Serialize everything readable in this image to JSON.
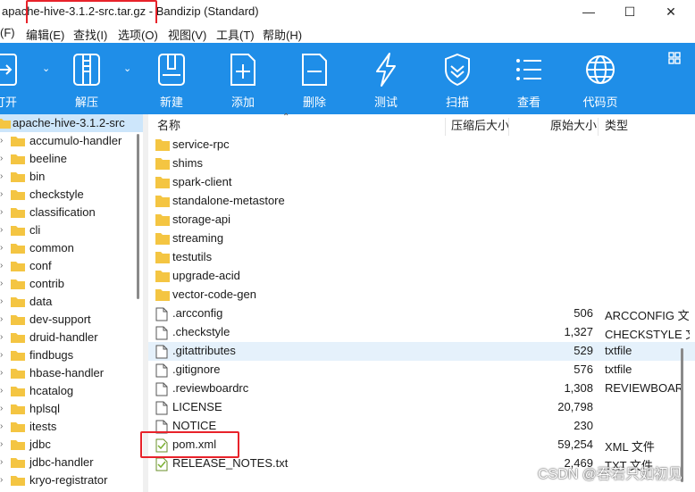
{
  "window": {
    "title": "apache-hive-3.1.2-src.tar.gz - Bandizip (Standard)",
    "minimize": "—",
    "maximize": "☐",
    "close": "✕"
  },
  "menu": [
    "(F)",
    "编辑(E)",
    "查找(I)",
    "选项(O)",
    "视图(V)",
    "工具(T)",
    "帮助(H)"
  ],
  "toolbar": {
    "open": "打开",
    "extract": "解压",
    "new": "新建",
    "add": "添加",
    "delete": "删除",
    "test": "测试",
    "scan": "扫描",
    "view": "查看",
    "codepage": "代码页"
  },
  "tree": {
    "root": "apache-hive-3.1.2-src",
    "items": [
      "accumulo-handler",
      "beeline",
      "bin",
      "checkstyle",
      "classification",
      "cli",
      "common",
      "conf",
      "contrib",
      "data",
      "dev-support",
      "druid-handler",
      "findbugs",
      "hbase-handler",
      "hcatalog",
      "hplsql",
      "itests",
      "jdbc",
      "jdbc-handler",
      "kryo-registrator"
    ]
  },
  "columns": {
    "name": "名称",
    "packed": "压缩后大小",
    "original": "原始大小",
    "type": "类型"
  },
  "files": [
    {
      "name": "service-rpc",
      "size": "",
      "type": "",
      "kind": "folder"
    },
    {
      "name": "shims",
      "size": "",
      "type": "",
      "kind": "folder"
    },
    {
      "name": "spark-client",
      "size": "",
      "type": "",
      "kind": "folder"
    },
    {
      "name": "standalone-metastore",
      "size": "",
      "type": "",
      "kind": "folder"
    },
    {
      "name": "storage-api",
      "size": "",
      "type": "",
      "kind": "folder"
    },
    {
      "name": "streaming",
      "size": "",
      "type": "",
      "kind": "folder"
    },
    {
      "name": "testutils",
      "size": "",
      "type": "",
      "kind": "folder"
    },
    {
      "name": "upgrade-acid",
      "size": "",
      "type": "",
      "kind": "folder"
    },
    {
      "name": "vector-code-gen",
      "size": "",
      "type": "",
      "kind": "folder"
    },
    {
      "name": ".arcconfig",
      "size": "506",
      "type": "ARCCONFIG 文",
      "kind": "file"
    },
    {
      "name": ".checkstyle",
      "size": "1,327",
      "type": "CHECKSTYLE 文",
      "kind": "file"
    },
    {
      "name": ".gitattributes",
      "size": "529",
      "type": "txtfile",
      "kind": "file"
    },
    {
      "name": ".gitignore",
      "size": "576",
      "type": "txtfile",
      "kind": "file"
    },
    {
      "name": ".reviewboardrc",
      "size": "1,308",
      "type": "REVIEWBOAR",
      "kind": "file"
    },
    {
      "name": "LICENSE",
      "size": "20,798",
      "type": "",
      "kind": "file"
    },
    {
      "name": "NOTICE",
      "size": "230",
      "type": "",
      "kind": "file"
    },
    {
      "name": "pom.xml",
      "size": "59,254",
      "type": "XML 文件",
      "kind": "xml"
    },
    {
      "name": "RELEASE_NOTES.txt",
      "size": "2,469",
      "type": "TXT 文件",
      "kind": "txt"
    }
  ],
  "watermark": "CSDN @吞若只如初见",
  "colors": {
    "toolbar": "#1f8ee8",
    "selection": "#e5f1fb",
    "highlight_box": "#e8222a",
    "folder": "#f4c542"
  }
}
